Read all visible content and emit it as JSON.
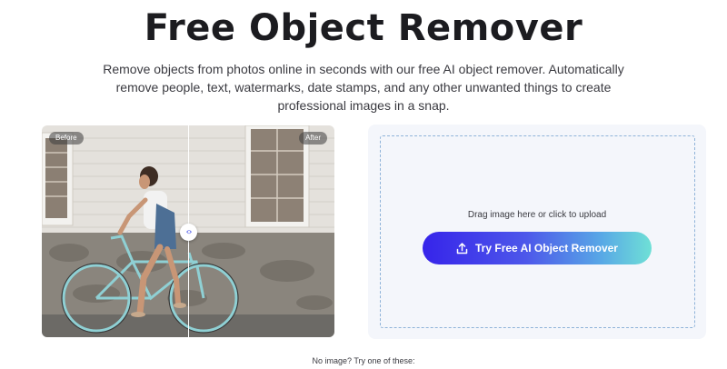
{
  "header": {
    "title": "Free Object Remover",
    "subtitle": "Remove objects from photos online in seconds with our free AI object remover. Automatically remove people, text, watermarks, date stamps, and any other unwanted things to create professional images in a snap."
  },
  "comparison": {
    "before_label": "Before",
    "after_label": "After",
    "handle_icon": "left-right-arrows-icon"
  },
  "upload": {
    "drop_text": "Drag image here or click to upload",
    "button_label": "Try Free AI Object Remover",
    "button_icon": "upload-icon"
  },
  "samples": {
    "prompt": "No image? Try one of these:"
  },
  "colors": {
    "accent_start": "#3624ea",
    "accent_end": "#6fe0d6",
    "panel_bg": "#f4f6fb",
    "dash_border": "#8fb3d9"
  }
}
